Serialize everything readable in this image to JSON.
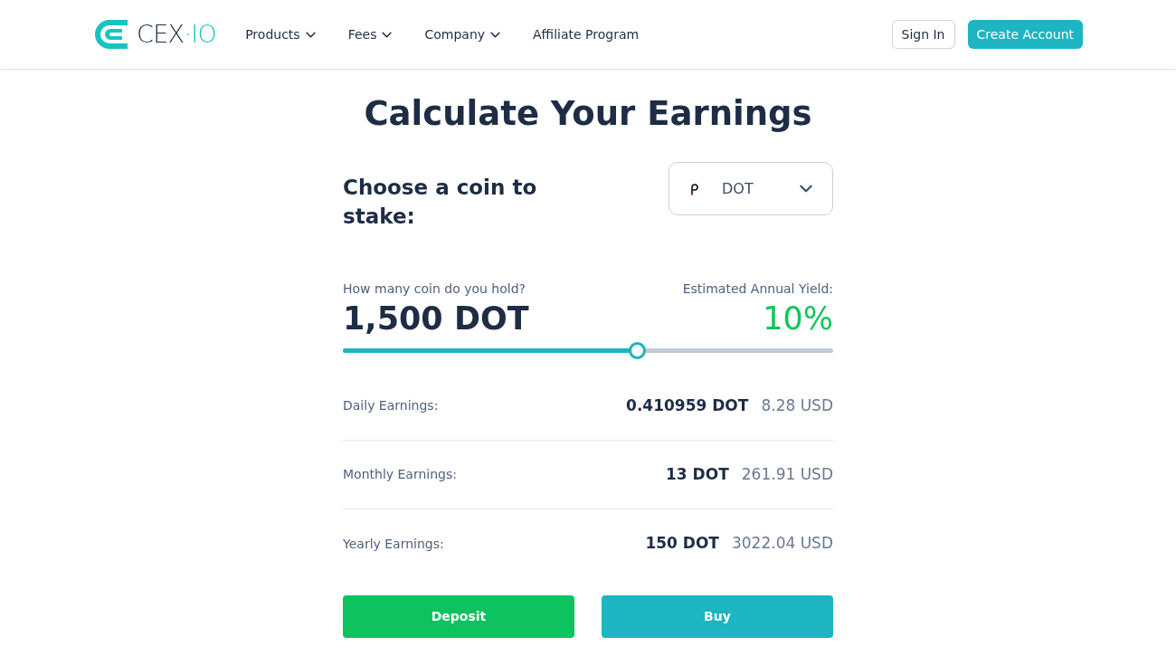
{
  "header": {
    "logo": {
      "main": "CEX",
      "accent": "·IO"
    },
    "nav": [
      {
        "label": "Products",
        "dropdown": true
      },
      {
        "label": "Fees",
        "dropdown": true
      },
      {
        "label": "Company",
        "dropdown": true
      },
      {
        "label": "Affiliate Program",
        "dropdown": false
      }
    ],
    "sign_in": "Sign In",
    "create_account": "Create Account"
  },
  "title": "Calculate Your Earnings",
  "coin_picker": {
    "label": "Choose a coin to stake:",
    "value": "DOT"
  },
  "holding": {
    "label": "How many coin do you hold?",
    "value": "1,500 DOT",
    "level": 0.6
  },
  "yield": {
    "label": "Estimated Annual Yield:",
    "value": "10%"
  },
  "earnings": [
    {
      "label": "Daily Earnings:",
      "coin": "0.410959 DOT",
      "usd": "8.28 USD"
    },
    {
      "label": "Monthly Earnings:",
      "coin": "13 DOT",
      "usd": "261.91 USD"
    },
    {
      "label": "Yearly Earnings:",
      "coin": "150 DOT",
      "usd": "3022.04 USD"
    }
  ],
  "actions": {
    "deposit": "Deposit",
    "buy": "Buy"
  }
}
